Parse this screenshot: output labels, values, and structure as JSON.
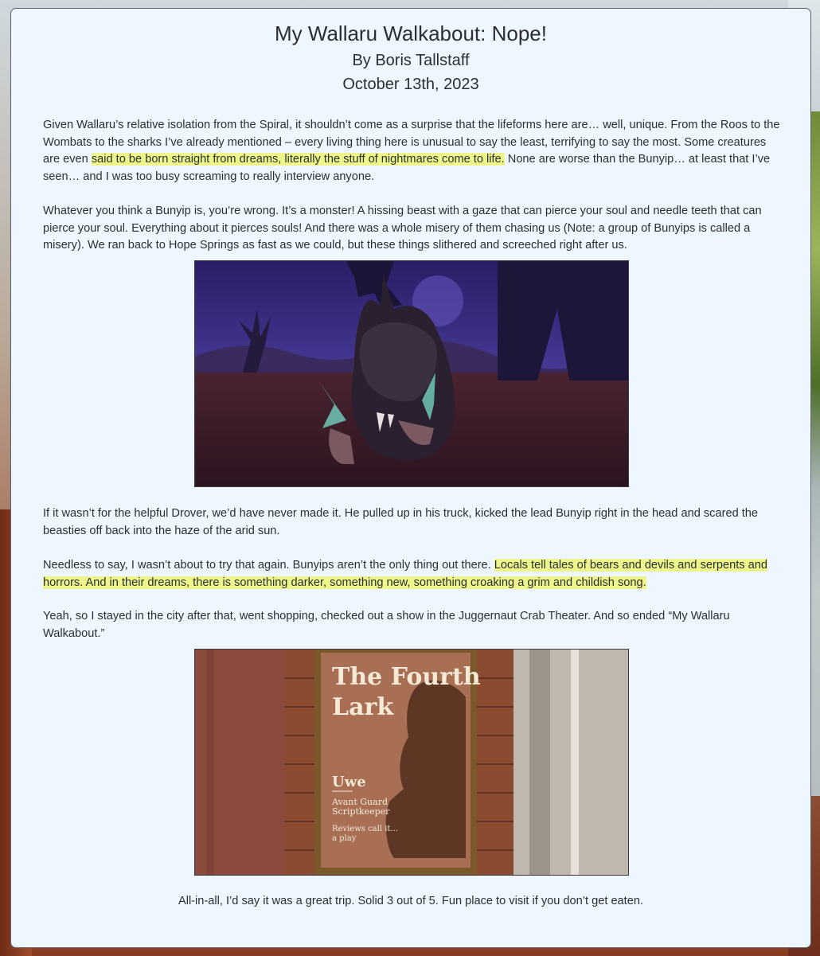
{
  "article": {
    "title": "My Wallaru Walkabout: Nope!",
    "author": "By Boris Tallstaff",
    "date": "October 13th, 2023",
    "p1": {
      "a": "Given Wallaru’s relative isolation from the Spiral, it shouldn’t come as a surprise that the lifeforms here are… well, unique. From the Roos to the Wombats to the sharks I’ve already mentioned – every living thing here is unusual to say the least, terrifying to say the most. Some creatures are even ",
      "highlight": "said to be born straight from dreams, literally the stuff of nightmares come to life.",
      "b": " None are worse than the Bunyip… at least that I’ve seen… and I was too busy screaming to really interview anyone."
    },
    "p2": "Whatever you think a Bunyip is, you’re wrong. It’s a monster! A hissing beast with a gaze that can pierce your soul and needle teeth that can pierce your soul. Everything about it pierces souls! And there was a whole misery of them chasing us (Note: a group of Bunyips is called a misery). We ran back to Hope Springs as fast as we could, but these things slithered and screeched right after us.",
    "p3": "If it wasn’t for the helpful Drover, we’d have never made it. He pulled up in his truck, kicked the lead Bunyip right in the head and scared the beasties off back into the haze of the arid sun.",
    "p4": {
      "a": "Needless to say, I wasn’t about to try that again. Bunyips aren’t the only thing out there. ",
      "highlight": "Locals tell tales of bears and devils and serpents and horrors. And in their dreams, there is something darker, something new, something croaking a grim and childish song.",
      "b": ""
    },
    "p5": "Yeah, so I stayed in the city after that, went shopping, checked out a show in the Juggernaut Crab Theater. And so ended “My Wallaru Walkabout.”",
    "closing": "All-in-all, I’d say it was a great trip. Solid 3 out of 5. Fun place to visit if you don’t get eaten."
  },
  "poster": {
    "title_line1": "The Fourth",
    "title_line2": "Lark",
    "name": "Uwe",
    "role_line1": "Avant Guard",
    "role_line2": "Scriptkeeper",
    "tag_line1": "Reviews call it...",
    "tag_line2": "a play"
  },
  "colors": {
    "panel_bg": "#eef6ff",
    "highlight": "#eef58a",
    "text": "#2b2f33"
  }
}
